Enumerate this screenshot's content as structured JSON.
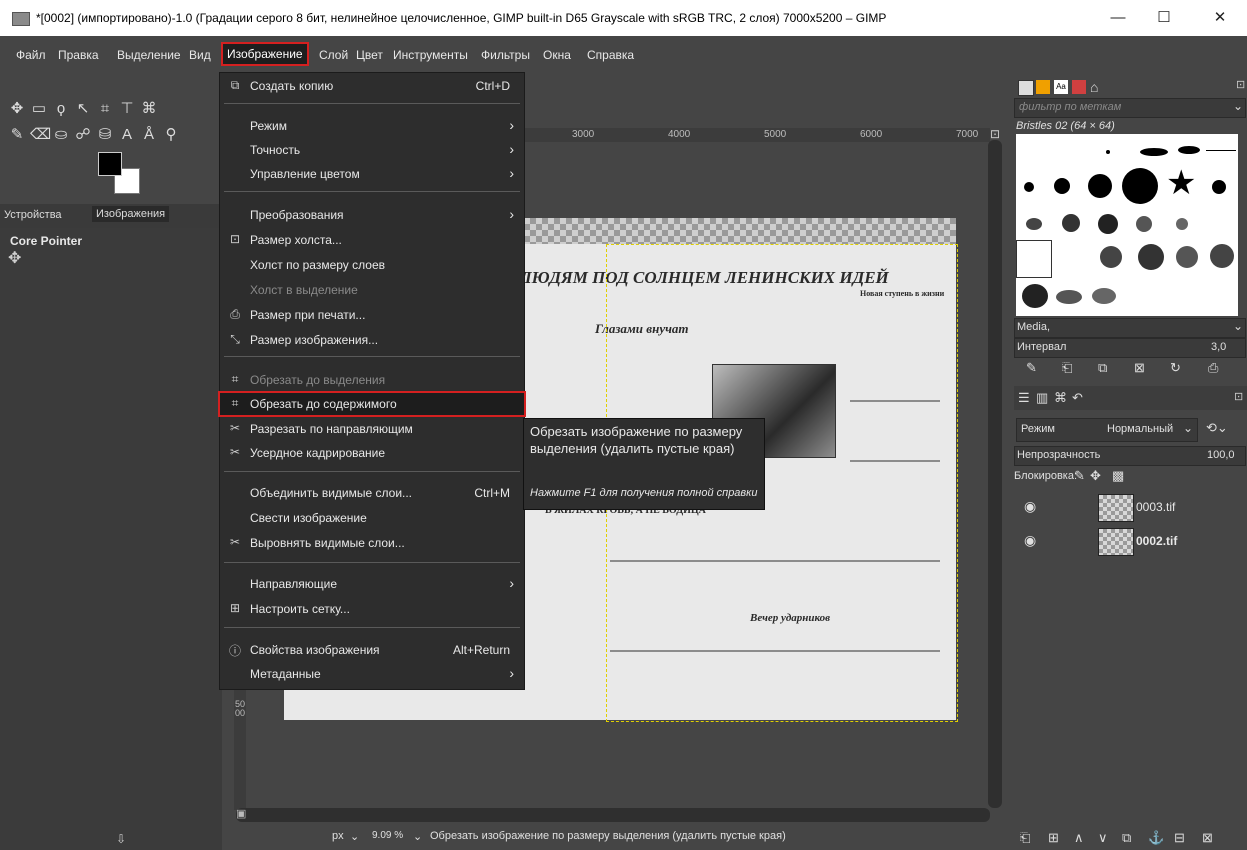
{
  "window": {
    "title": "*[0002] (импортировано)-1.0 (Градации серого 8 бит, нелинейное целочисленное, GIMP built-in D65 Grayscale with sRGB TRC, 2 слоя) 7000x5200 – GIMP",
    "minimize": "—",
    "maximize": "☐",
    "close": "✕"
  },
  "menubar": [
    "Файл",
    "Правка",
    "Выделение",
    "Вид",
    "Изображение",
    "Слой",
    "Цвет",
    "Инструменты",
    "Фильтры",
    "Окна",
    "Справка"
  ],
  "left_panel": {
    "tabs": [
      "Устройства",
      "Изображения"
    ],
    "device": "Core Pointer"
  },
  "rulers": {
    "h": [
      "3000",
      "4000",
      "5000",
      "6000",
      "7000"
    ],
    "v": [
      "5000"
    ]
  },
  "document": {
    "headline": "ЛЮДЯМ ПОД СОЛНЦЕМ ЛЕНИНСКИХ ИДЕЙ",
    "subhead_1": "Глазами внучат",
    "subhead_2": "Новая ступень в жизни",
    "subhead_3": "В ЖИЛАХ КРОВЬ, А НЕ ВОДИЦА",
    "subhead_4": "Вечер ударников"
  },
  "image_menu": {
    "items": [
      {
        "label": "Создать копию",
        "accel": "Ctrl+D",
        "icon": "⧉"
      },
      {
        "label": "Режим",
        "submenu": true
      },
      {
        "label": "Точность",
        "submenu": true
      },
      {
        "label": "Управление цветом",
        "submenu": true
      },
      {
        "label": "Преобразования",
        "submenu": true
      },
      {
        "label": "Размер холста...",
        "icon": "⊡"
      },
      {
        "label": "Холст по размеру слоев"
      },
      {
        "label": "Холст в выделение",
        "disabled": true
      },
      {
        "label": "Размер при печати...",
        "icon": "⎙"
      },
      {
        "label": "Размер изображения...",
        "icon": "⤡"
      },
      {
        "label": "Обрезать до выделения",
        "disabled": true,
        "icon": "⌗"
      },
      {
        "label": "Обрезать до содержимого",
        "icon": "⌗",
        "highlighted": true
      },
      {
        "label": "Разрезать по направляющим",
        "icon": "✂"
      },
      {
        "label": "Усердное кадрирование",
        "icon": "✂"
      },
      {
        "label": "Объединить видимые слои...",
        "accel": "Ctrl+M"
      },
      {
        "label": "Свести изображение"
      },
      {
        "label": "Выровнять видимые слои...",
        "icon": "✂"
      },
      {
        "label": "Направляющие",
        "submenu": true
      },
      {
        "label": "Настроить сетку...",
        "icon": "⊞"
      },
      {
        "label": "Свойства изображения",
        "accel": "Alt+Return",
        "icon": "ⓘ"
      },
      {
        "label": "Метаданные",
        "submenu": true
      }
    ]
  },
  "tooltip": {
    "text": "Обрезать изображение по размеру выделения (удалить пустые края)",
    "hint": "Нажмите F1 для получения полной справки"
  },
  "statusbar": {
    "unit": "px",
    "zoom": "9.09 %",
    "message": "Обрезать изображение по размеру выделения (удалить пустые края)"
  },
  "brushes": {
    "filter_placeholder": "фильтр по меткам",
    "selected": "Bristles 02 (64 × 64)",
    "category": "Media,",
    "spacing_label": "Интервал",
    "spacing_value": "3,0"
  },
  "layers": {
    "mode_label": "Режим",
    "mode_value": "Нормальный",
    "opacity_label": "Непрозрачность",
    "opacity_value": "100,0",
    "lock_label": "Блокировка:",
    "items": [
      {
        "name": "0003.tif",
        "bold": false
      },
      {
        "name": "0002.tif",
        "bold": true
      }
    ]
  },
  "colors": {
    "accent_red": "#d42020",
    "selection_dash": "#e0d000"
  }
}
